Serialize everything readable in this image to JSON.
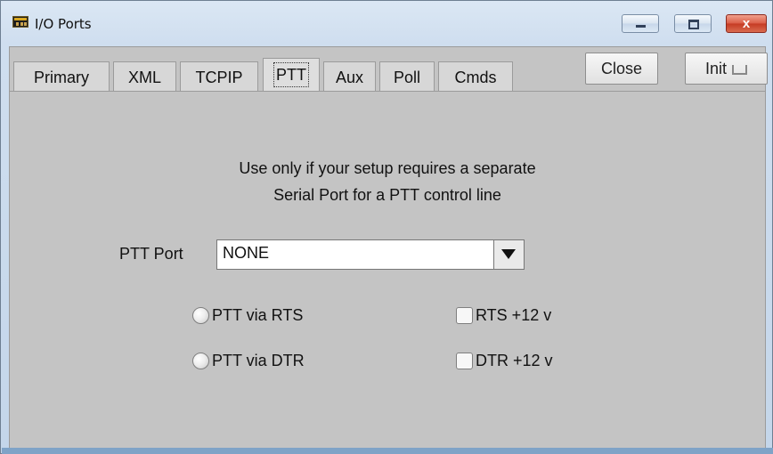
{
  "window": {
    "title": "I/O Ports",
    "controls": {
      "close_glyph": "x"
    }
  },
  "tabs": [
    {
      "label": "Primary"
    },
    {
      "label": "XML"
    },
    {
      "label": "TCPIP"
    },
    {
      "label": "PTT"
    },
    {
      "label": "Aux"
    },
    {
      "label": "Poll"
    },
    {
      "label": "Cmds"
    }
  ],
  "active_tab": "PTT",
  "actions": {
    "close": "Close",
    "init": "Init"
  },
  "message": [
    "Use only if your setup requires a separate",
    "Serial Port for a PTT control line"
  ],
  "ptt_port": {
    "label": "PTT Port",
    "value": "NONE"
  },
  "options": {
    "rts_radio": "PTT via RTS",
    "dtr_radio": "PTT via DTR",
    "rts_check": "RTS +12 v",
    "dtr_check": "DTR +12 v"
  },
  "icons": {
    "app": "i-o-ports-app-icon",
    "minimize": "minimize-icon",
    "maximize": "maximize-icon",
    "close": "close-icon",
    "dropdown": "chevron-down-icon",
    "init": "enter-icon"
  },
  "colors": {
    "title_bar": "#cfdeef",
    "dialog_background": "#c4c4c4",
    "close_button": "#d95a44"
  }
}
